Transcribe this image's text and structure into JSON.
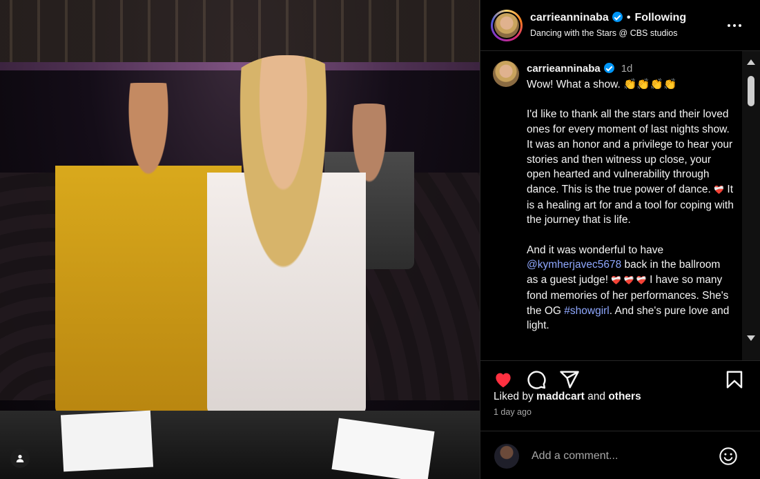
{
  "post": {
    "image_alt": "",
    "user_tag_icon": "person-icon"
  },
  "header": {
    "username": "carrieanninaba",
    "separator": "•",
    "follow_status": "Following",
    "location": "Dancing with the Stars @ CBS studios"
  },
  "caption": {
    "username": "carrieanninaba",
    "time": "1d",
    "paragraphs": [
      {
        "text": "Wow! What a show. 👏👏👏👏"
      },
      {
        "text_before": "I'd like to thank all the stars and their loved ones for every moment of last nights show. It was an honor and a privilege to hear your stories and then witness up close, your open hearted and vulnerability through dance.  This is the true power of dance. ",
        "emoji": "❤️‍🩹",
        "text_after": " It is a healing art for and a tool for coping with the journey that is life."
      },
      {
        "text_before": "And it was wonderful to have ",
        "mention": "@kymherjavec5678",
        "text_middle": " back in the ballroom as a guest judge! ",
        "emojis": "❤️‍🩹 ❤️‍🩹  ❤️‍🩹",
        "text_after": " I have so many fond memories of her performances. She's the OG ",
        "hashtag": "#showgirl",
        "text_end": ".  And she's pure love and light."
      }
    ]
  },
  "stats": {
    "liked_prefix": "Liked by ",
    "liked_user": "maddcart",
    "liked_and": " and ",
    "liked_others": "others",
    "time_ago": "1 day ago"
  },
  "comment": {
    "placeholder": "Add a comment..."
  },
  "colors": {
    "like": "#ff3040",
    "verified": "#0095f6",
    "mention": "#8fa8ff"
  }
}
